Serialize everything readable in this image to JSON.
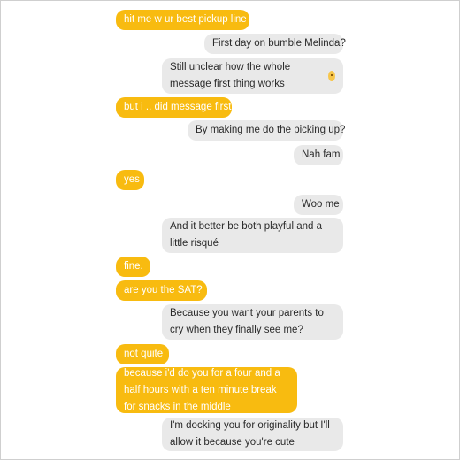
{
  "conversation": {
    "messages": [
      {
        "sender": "me",
        "text": "hit me w ur best pickup line"
      },
      {
        "sender": "them",
        "text": "First day on bumble Melinda?"
      },
      {
        "sender": "them",
        "text": "Still unclear how the whole message first thing works"
      },
      {
        "sender": "me",
        "text": "but i .. did message first"
      },
      {
        "sender": "them",
        "text": "By making me do the picking up?"
      },
      {
        "sender": "them",
        "text": "Nah fam"
      },
      {
        "sender": "me",
        "text": "yes"
      },
      {
        "sender": "them",
        "text": "Woo me"
      },
      {
        "sender": "them",
        "text": "And it better be both playful and a little risqué"
      },
      {
        "sender": "me",
        "text": "fine."
      },
      {
        "sender": "me",
        "text": "are you the SAT?"
      },
      {
        "sender": "them",
        "text": "Because you want your parents to cry when they finally see me?"
      },
      {
        "sender": "me",
        "text": "not quite"
      },
      {
        "sender": "me",
        "text": "because i'd do you for a four and a half hours with a ten minute break for snacks in the middle"
      },
      {
        "sender": "them",
        "text": "I'm docking you for originality but I'll allow it because you're cute"
      }
    ],
    "colors": {
      "me_bubble": "#f8bb10",
      "them_bubble": "#e9e9e9"
    },
    "emoji_icon": "grinning-face-icon"
  }
}
